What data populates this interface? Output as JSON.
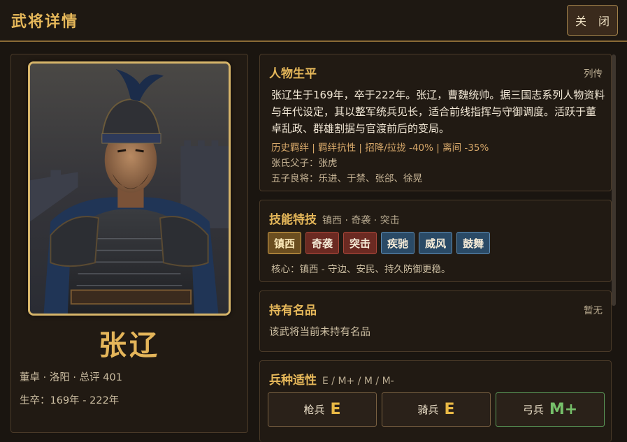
{
  "header": {
    "title": "武将详情",
    "close_label": "关 闭"
  },
  "hero": {
    "name": "张辽",
    "meta": "董卓 · 洛阳 · 总评 401",
    "life": "生卒：169年 - 222年"
  },
  "bio": {
    "title": "人物生平",
    "link": "列传",
    "text": "张辽生于169年，卒于222年。张辽，曹魏统帅。据三国志系列人物资料与年代设定，其以整军统兵见长，适合前线指挥与守御调度。活跃于董卓乱政、群雄割据与官渡前后的变局。",
    "bonds": "历史羁绊 | 羁绊抗性 | 招降/拉拢 -40% | 离间 -35%",
    "family": "张氏父子：张虎",
    "generals": "五子良将：乐进、于禁、张郃、徐晃"
  },
  "skills": {
    "title": "技能特技",
    "subtitle": "镇西 · 奇袭 · 突击",
    "tags": [
      {
        "label": "镇西",
        "style": "gold"
      },
      {
        "label": "奇袭",
        "style": "red"
      },
      {
        "label": "突击",
        "style": "red"
      },
      {
        "label": "疾驰",
        "style": "blue"
      },
      {
        "label": "威风",
        "style": "blue"
      },
      {
        "label": "鼓舞",
        "style": "blue"
      }
    ],
    "core": "核心：镇西 - 守边、安民、持久防御更稳。"
  },
  "treasure": {
    "title": "持有名品",
    "status": "暂无",
    "text": "该武将当前未持有名品"
  },
  "troops": {
    "title": "兵种适性",
    "subtitle": "E / M+ / M / M-",
    "items": [
      {
        "label": "枪兵",
        "grade": "E"
      },
      {
        "label": "骑兵",
        "grade": "E"
      },
      {
        "label": "弓兵",
        "grade": "M+"
      }
    ]
  },
  "colors": {
    "accent": "#e6b85a",
    "background": "#1a1510",
    "skill_gold": "#d9a64c",
    "skill_red": "#a8473a",
    "skill_blue": "#5d8ab0",
    "grade_good": "#76c06a"
  }
}
